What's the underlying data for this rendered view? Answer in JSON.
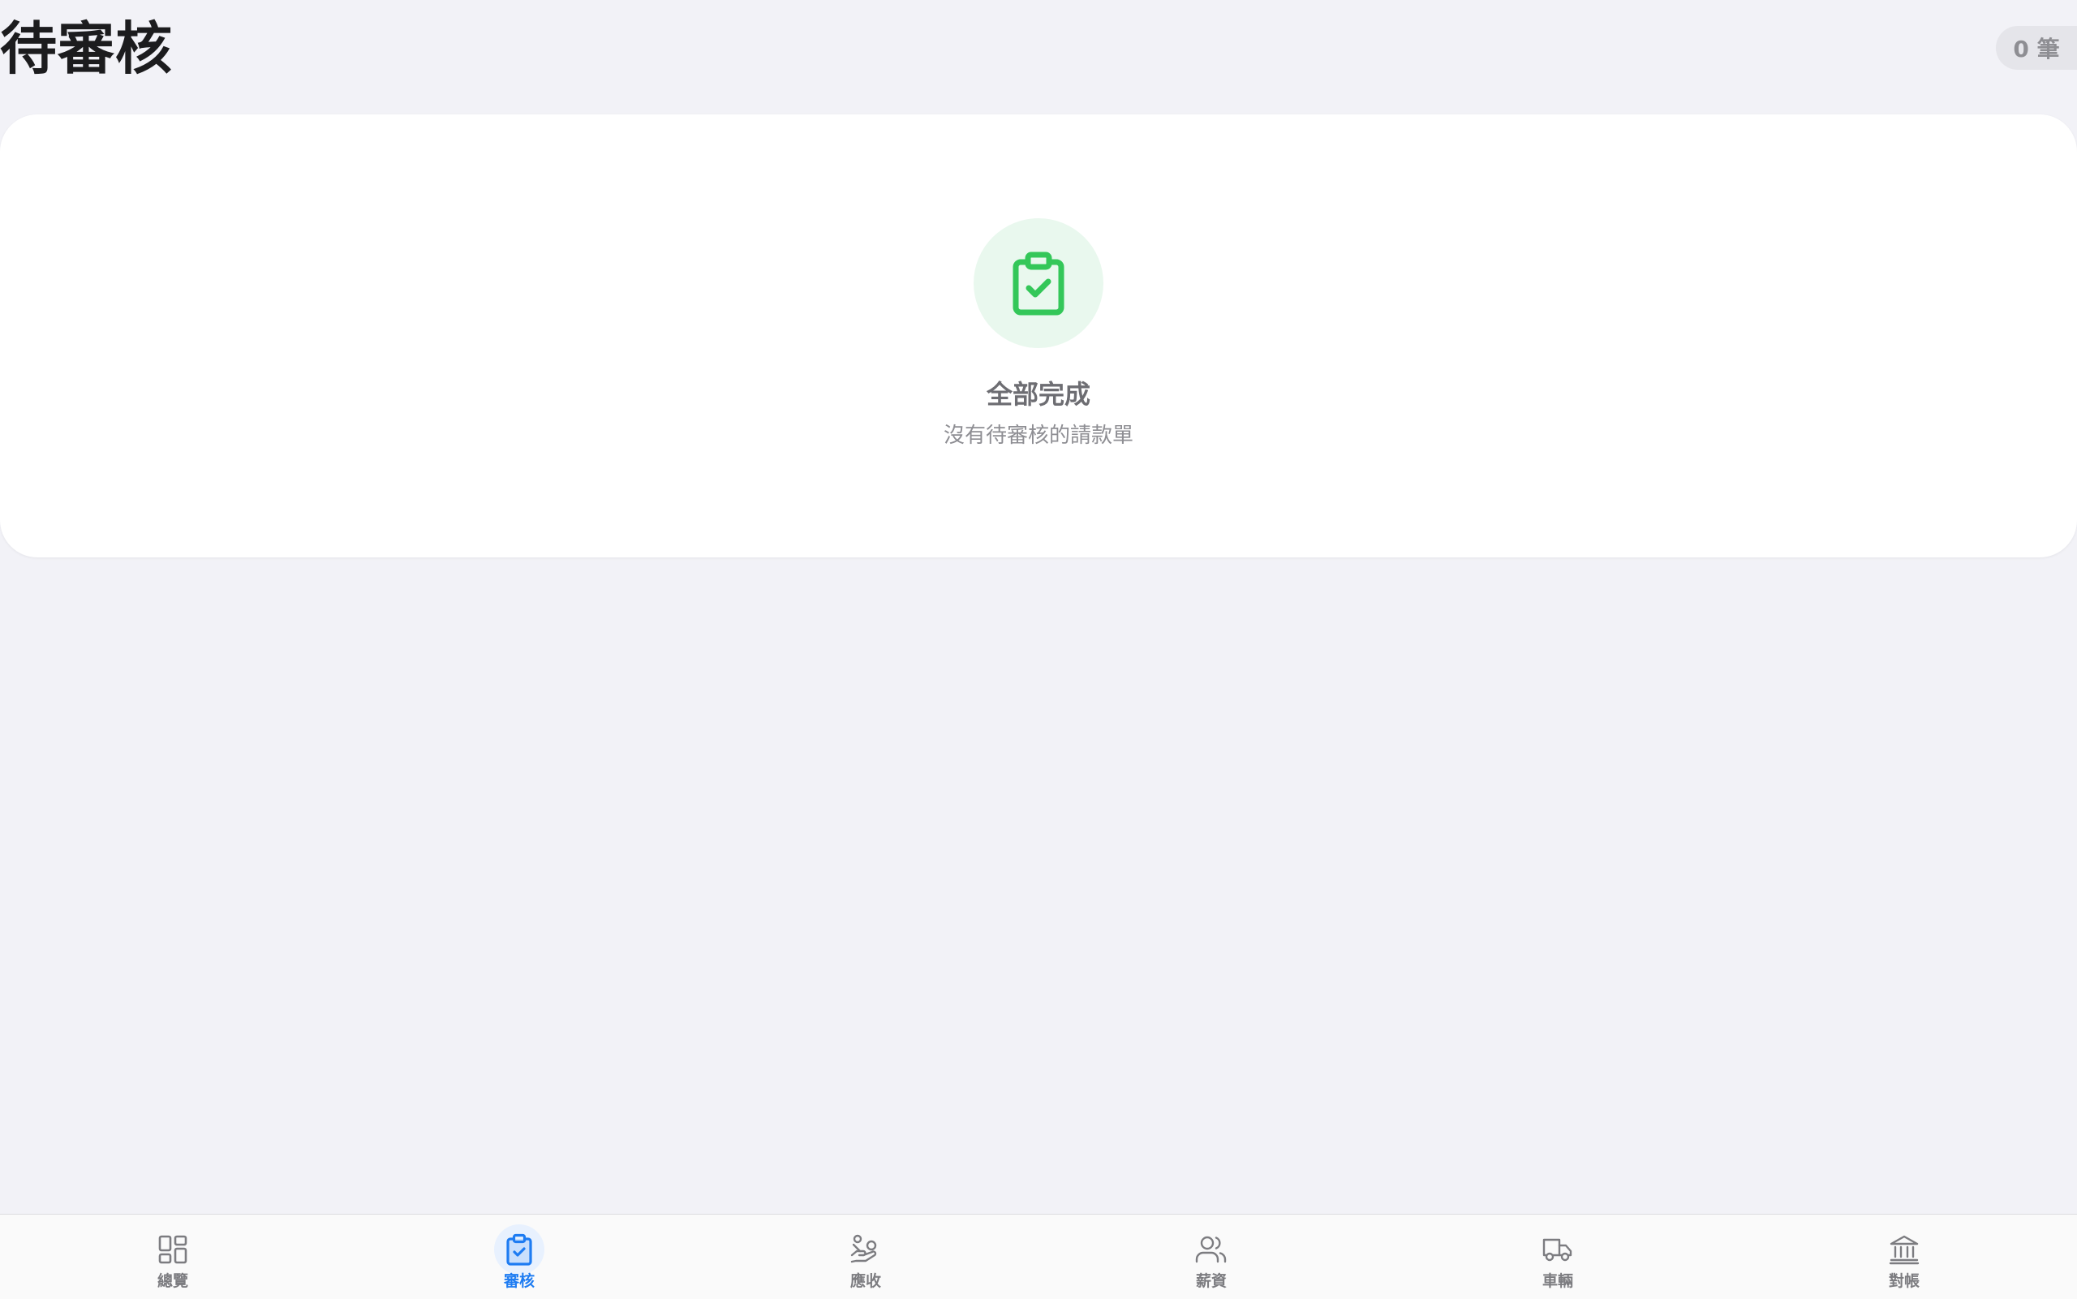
{
  "header": {
    "title": "待審核",
    "count_badge": "0 筆"
  },
  "empty_state": {
    "icon": "clipboard-check-icon",
    "title": "全部完成",
    "subtitle": "沒有待審核的請款單"
  },
  "tab_bar": {
    "active_color": "#1e7cf2",
    "inactive_color": "#7c7c80",
    "items": [
      {
        "label": "總覽",
        "icon": "grid-icon",
        "active": false
      },
      {
        "label": "審核",
        "icon": "clipboard-check-icon",
        "active": true
      },
      {
        "label": "應收",
        "icon": "hand-coins-icon",
        "active": false
      },
      {
        "label": "薪資",
        "icon": "users-icon",
        "active": false
      },
      {
        "label": "車輛",
        "icon": "truck-icon",
        "active": false
      },
      {
        "label": "對帳",
        "icon": "bank-icon",
        "active": false
      }
    ]
  },
  "colors": {
    "background": "#f2f2f7",
    "success_green": "#34c759",
    "success_tint": "#e9f8ee"
  }
}
